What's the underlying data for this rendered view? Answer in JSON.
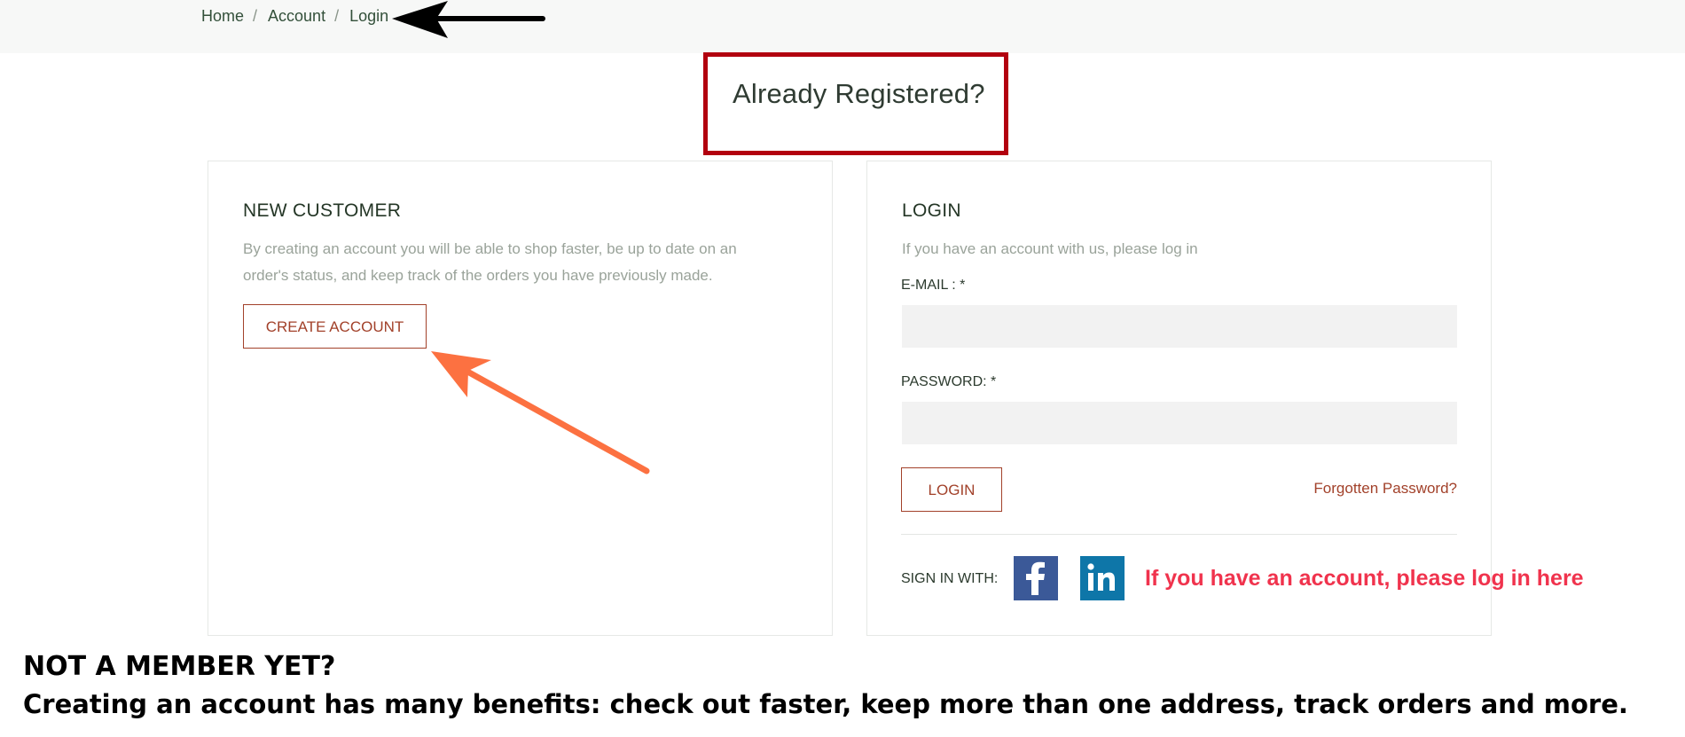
{
  "breadcrumb": {
    "items": [
      "Home",
      "Account",
      "Login"
    ],
    "separator": "/"
  },
  "page_heading": "Already Registered?",
  "new_customer": {
    "title": "NEW CUSTOMER",
    "description": "By creating an account you will be able to shop faster, be up to date on an order's status, and keep track of the orders you have previously made.",
    "create_button": "CREATE ACCOUNT"
  },
  "login": {
    "title": "LOGIN",
    "description": "If you have an account with us, please log in",
    "email_label": "E-MAIL : *",
    "email_value": "",
    "password_label": "PASSWORD: *",
    "password_value": "",
    "login_button": "LOGIN",
    "forgot_link": "Forgotten Password?",
    "sign_in_with": "SIGN IN WITH:",
    "social": [
      {
        "name": "facebook-icon",
        "glyph": "f",
        "color": "#3b5998"
      },
      {
        "name": "linkedin-icon",
        "glyph": "in",
        "color": "#0e76a8"
      }
    ]
  },
  "annotations": {
    "red_note": "If you have an account, please log in here",
    "black_line1": "NOT A MEMBER YET?",
    "black_line2": "Creating an account has many benefits: check out faster, keep more than one address, track orders and more."
  },
  "colors": {
    "accent": "#a2412a",
    "highlight_box": "#b2000f",
    "annotation_red": "#f0334d",
    "arrow_orange": "#fc7141"
  }
}
